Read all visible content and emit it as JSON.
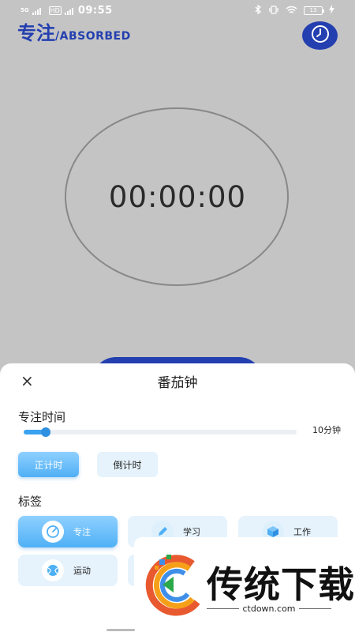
{
  "status_bar": {
    "signal_label": "5G",
    "hd_label": "HD",
    "time": "09:55",
    "battery": "13"
  },
  "header": {
    "title_cn": "专注",
    "title_en": "/ABSORBED",
    "history_icon": "clock-icon"
  },
  "timer": {
    "display": "00:00:00"
  },
  "sheet": {
    "close_icon": "×",
    "title": "番茄钟",
    "duration_label": "专注时间",
    "duration_value": "10分钟",
    "duration_fraction": 0.08,
    "mode_buttons": {
      "count_up": "正计时",
      "count_down": "倒计时"
    },
    "tags_label": "标签",
    "tags": [
      {
        "label": "专注",
        "icon": "target-icon"
      },
      {
        "label": "学习",
        "icon": "pencil-icon"
      },
      {
        "label": "工作",
        "icon": "box-icon"
      },
      {
        "label": "运动",
        "icon": "ball-icon"
      }
    ]
  },
  "watermark": {
    "name": "传统下载",
    "url": "ctdown.com"
  },
  "colors": {
    "accent": "#233fb0",
    "light_blue": "#4fb0f5",
    "background": "#c4c4c4"
  }
}
